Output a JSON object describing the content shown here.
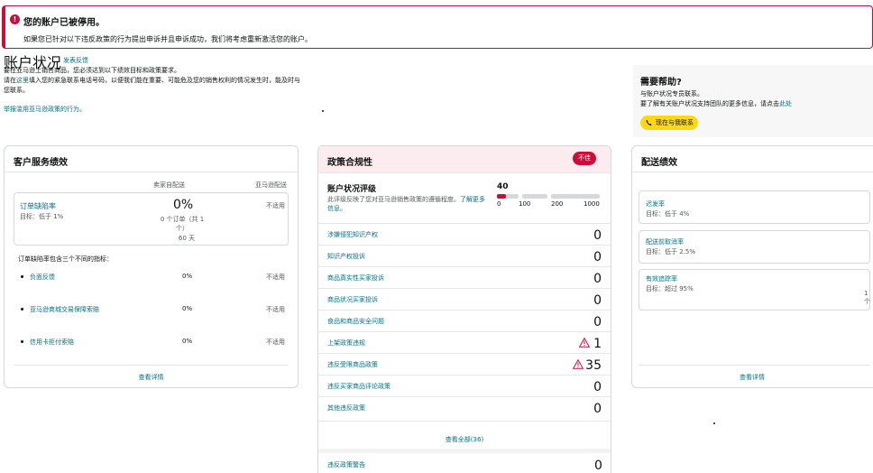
{
  "alert": {
    "icon": "exclamation-icon",
    "title": "您的账户已被停用。",
    "body": "如果您已针对以下违反政策的行为提出申诉并且申诉成功，我们将考虑重新激活您的账户。"
  },
  "header": {
    "title": "账户状况",
    "feedback": "发表反馈",
    "desc1": "要在亚马逊上销售商品，您必须达到以下绩效目标和政策要求。",
    "desc2_pre": "请在",
    "desc2_link": "这里",
    "desc2_post": "填入您的紧急联系电话号码，以便我们能在重要、可能危及您的销售权利的情况发生时，能及时与您联系。",
    "report": "举报滥用亚马逊政策的行为。"
  },
  "help": {
    "title": "需要帮助?",
    "line1": "与账户状况专员联系。",
    "line2_pre": "要了解有关账户状况支持团队的更多信息，请点击",
    "line2_link": "此处",
    "button": "现在与我联系",
    "button_icon": "phone-icon"
  },
  "customer_service": {
    "title": "客户服务绩效",
    "col_seller": "卖家自配送",
    "col_amazon": "亚马逊配送",
    "odr": {
      "label": "订单缺陷率",
      "target": "目标：低于 1%",
      "value": "0%",
      "orders_line1": "0 个订单（共 1",
      "orders_line2": "个）",
      "days": "60 天",
      "amazon": "不适用"
    },
    "subtitle": "订单缺陷率包含三个不同的指标：",
    "metrics": [
      {
        "label": "负面反馈",
        "seller": "0%",
        "amazon": "不适用"
      },
      {
        "label": "亚马逊商城交易保障索赔",
        "seller": "0%",
        "amazon": "不适用"
      },
      {
        "label": "信用卡拒付索赔",
        "seller": "0%",
        "amazon": "不适用"
      }
    ],
    "details": "查看详情"
  },
  "policy": {
    "title": "政策合规性",
    "badge": "不佳",
    "ahr_title": "账户状况评级",
    "ahr_desc_pre": "此评级反映了您对亚马逊销售政策的遵循程度。",
    "ahr_link1": "了解",
    "ahr_link2": "更多信息",
    "ahr_desc_post": "。",
    "score": "40",
    "score_value": 40,
    "score_max": 1000,
    "ticks": [
      "0",
      "100",
      "200",
      "1000"
    ],
    "colors": {
      "bad": "#cc0c39",
      "track": "#d5d9d9"
    },
    "items": [
      {
        "label": "涉嫌侵犯知识产权",
        "count": "0",
        "warn": false
      },
      {
        "label": "知识产权投诉",
        "count": "0",
        "warn": false
      },
      {
        "label": "商品真实性买家投诉",
        "count": "0",
        "warn": false
      },
      {
        "label": "商品状况买家投诉",
        "count": "0",
        "warn": false
      },
      {
        "label": "食品和商品安全问题",
        "count": "0",
        "warn": false
      },
      {
        "label": "上架政策违规",
        "count": "1",
        "warn": true
      },
      {
        "label": "违反受限商品政策",
        "count": "35",
        "warn": true
      },
      {
        "label": "违反买家商品评论政策",
        "count": "0",
        "warn": false
      },
      {
        "label": "其他违反政策",
        "count": "0",
        "warn": false
      }
    ],
    "view_all": "查看全部(36)",
    "warnings_label": "违反政策警告",
    "warnings_count": "0"
  },
  "shipping": {
    "title": "配送绩效",
    "metrics": [
      {
        "label": "迟发率",
        "target": "目标：低于 4%"
      },
      {
        "label": "配送前取消率",
        "target": "目标：低于 2.5%"
      },
      {
        "label": "有效追踪率",
        "target": "目标：超过 95%",
        "extra": "1 个"
      }
    ],
    "details": "查看详情"
  }
}
